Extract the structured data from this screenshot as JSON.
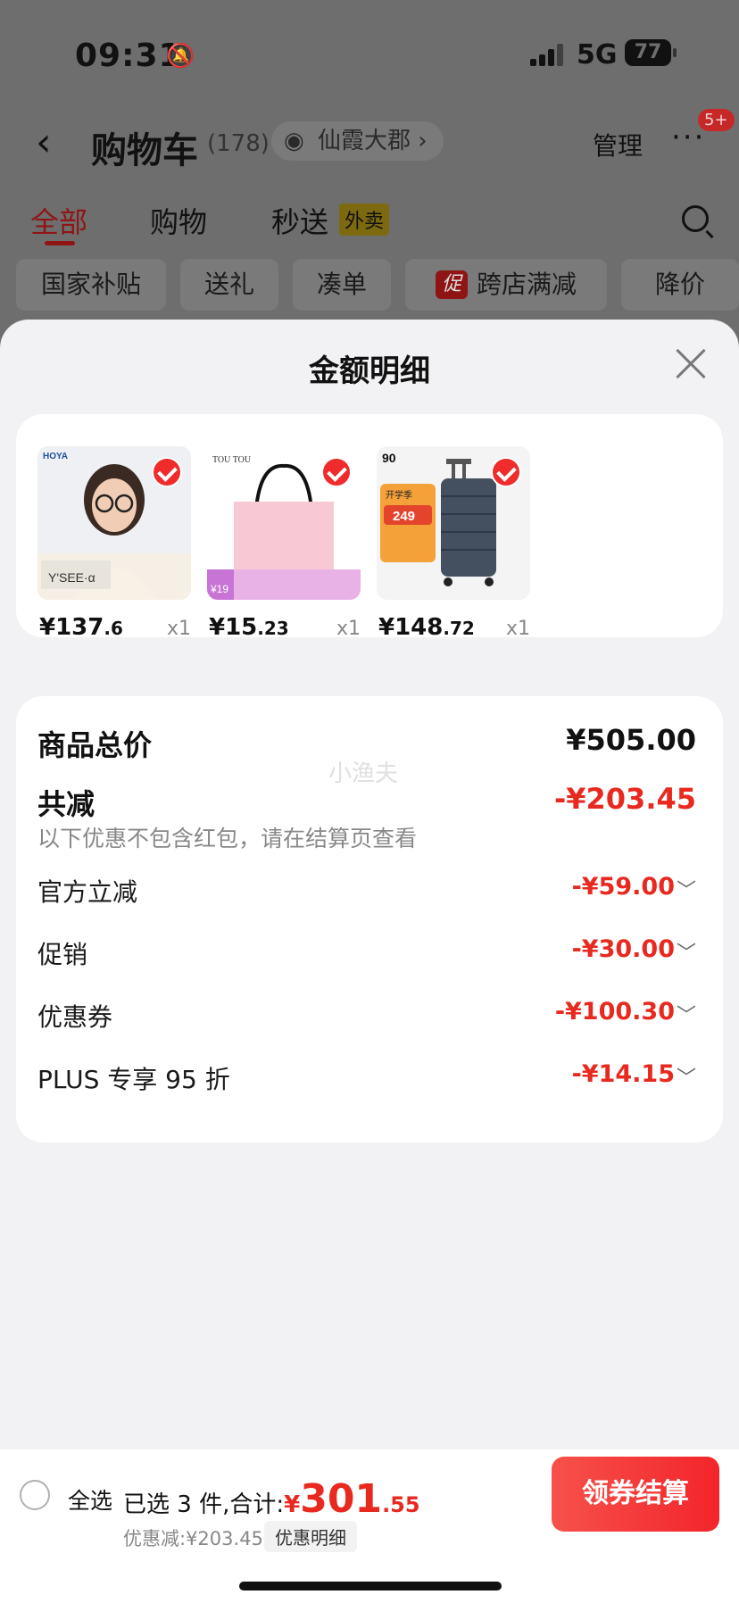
{
  "status_bar": {
    "time": "09:31",
    "network": "5G",
    "battery": "77"
  },
  "cart": {
    "title": "购物车",
    "count": "(178)",
    "location": "仙霞大郡",
    "manage": "管理",
    "more_badge": "5+",
    "tabs": [
      {
        "label": "全部"
      },
      {
        "label": "购物"
      },
      {
        "label": "秒送"
      }
    ],
    "takeaway_tag": "外卖",
    "chips": [
      "国家补贴",
      "送礼",
      "凑单",
      "跨店满减",
      "降价"
    ],
    "promo_icon_text": "促"
  },
  "sheet": {
    "title": "金额明细",
    "products": [
      {
        "price_int": "¥137",
        "price_dec": ".6",
        "qty": "x1",
        "brand": "HOYA",
        "thumb_tag": "Y'SEE·α",
        "thumb": "glasses-model"
      },
      {
        "price_int": "¥15",
        "price_dec": ".23",
        "qty": "x1",
        "brand": "TOU TOU",
        "thumb_tag": "¥19",
        "thumb": "pink-gift-bag"
      },
      {
        "price_int": "¥148",
        "price_dec": ".72",
        "qty": "x1",
        "brand": "开学季",
        "thumb_tag": "249",
        "thumb": "suitcase"
      }
    ],
    "total_label": "商品总价",
    "total_value": "¥505.00",
    "reduce_label": "共减",
    "reduce_value": "-¥203.45",
    "note": "以下优惠不包含红包，请在结算页查看",
    "watermark": "小渔夫",
    "discounts": [
      {
        "label": "官方立减",
        "value": "-¥59.00"
      },
      {
        "label": "促销",
        "value": "-¥30.00"
      },
      {
        "label": "优惠券",
        "value": "-¥100.30"
      },
      {
        "label": "PLUS 专享 95 折",
        "value": "-¥14.15"
      }
    ]
  },
  "bottom_bar": {
    "select_all": "全选",
    "selected_text": "已选 3 件,合计:",
    "total_symbol": "¥",
    "total_int": "301",
    "total_dec": ".55",
    "discount_text": "优惠减:¥203.45",
    "detail_chip": "优惠明细",
    "checkout": "领券结算"
  },
  "colors": {
    "accent_red": "#e8291f",
    "checkout_red": "#f3252a"
  }
}
